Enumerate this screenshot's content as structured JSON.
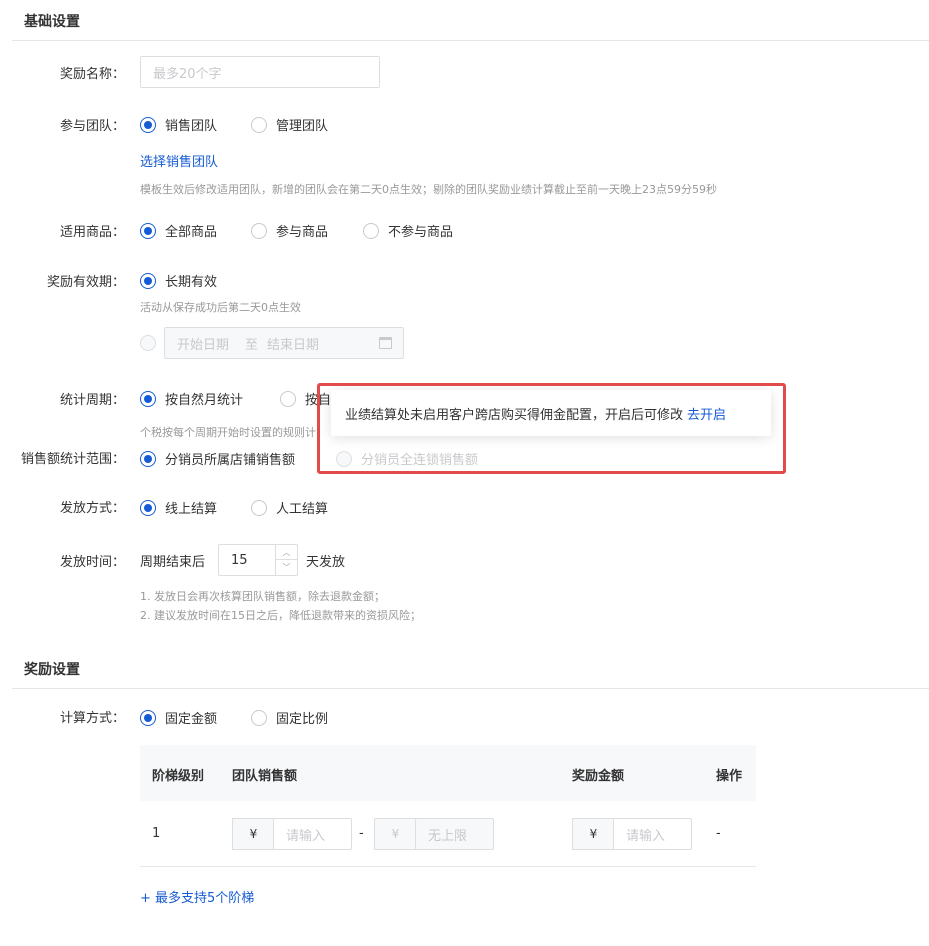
{
  "basic": {
    "title": "基础设置",
    "reward_name": {
      "label": "奖励名称：",
      "placeholder": "最多20个字"
    },
    "team": {
      "label": "参与团队：",
      "options": [
        "销售团队",
        "管理团队"
      ],
      "selected": 0,
      "select_link": "选择销售团队",
      "hint": "模板生效后修改适用团队，新增的团队会在第二天0点生效；剔除的团队奖励业绩计算截止至前一天晚上23点59分59秒"
    },
    "goods": {
      "label": "适用商品：",
      "options": [
        "全部商品",
        "参与商品",
        "不参与商品"
      ],
      "selected": 0
    },
    "validity": {
      "label": "奖励有效期：",
      "long_term": "长期有效",
      "hint": "活动从保存成功后第二天0点生效",
      "start_placeholder": "开始日期",
      "to": "至",
      "end_placeholder": "结束日期",
      "calendar_icon": "calendar-icon"
    },
    "period": {
      "label": "统计周期：",
      "option1": "按自然月统计",
      "option2_partial": "按自",
      "hint_partial": "个税按每个周期开始时设置的规则计"
    },
    "scope": {
      "label": "销售额统计范围：",
      "option1": "分销员所属店铺销售额",
      "option2": "分销员全连锁销售额"
    },
    "popover": {
      "text": "业绩结算处未启用客户跨店购买得佣金配置，开启后可修改",
      "link": "去开启"
    },
    "payout": {
      "label": "发放方式：",
      "options": [
        "线上结算",
        "人工结算"
      ],
      "selected": 0
    },
    "payout_time": {
      "label": "发放时间：",
      "prefix": "周期结束后",
      "value": "15",
      "suffix": "天发放",
      "up_icon": "chevron-up-icon",
      "down_icon": "chevron-down-icon",
      "note1": "1. 发放日会再次核算团队销售额，除去退款金额；",
      "note2": "2. 建议发放时间在15日之后，降低退款带来的资损风险；"
    }
  },
  "reward": {
    "title": "奖励设置",
    "calc": {
      "label": "计算方式：",
      "options": [
        "固定金额",
        "固定比例"
      ],
      "selected": 0
    },
    "table": {
      "headers": [
        "阶梯级别",
        "团队销售额",
        "奖励金额",
        "操作"
      ],
      "row": {
        "level": "1",
        "currency": "¥",
        "min_placeholder": "请输入",
        "dash": "-",
        "max_placeholder": "无上限",
        "reward_placeholder": "请输入",
        "action": "-"
      }
    },
    "add_link": "+ 最多支持5个阶梯"
  },
  "colors": {
    "accent": "#155bd4",
    "highlight_frame": "#e14b4b"
  }
}
